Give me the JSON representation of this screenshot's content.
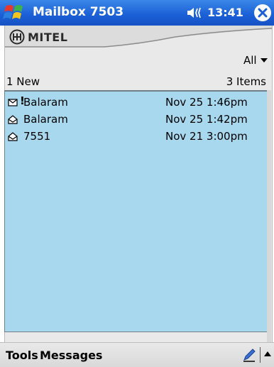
{
  "titlebar": {
    "title": "Mailbox 7503",
    "clock": "13:41"
  },
  "header": {
    "logo_text": "MITEL",
    "filter_value": "All",
    "new_count": "1 New",
    "item_count": "3 Items"
  },
  "messages": [
    {
      "sender": "Balaram",
      "date": "Nov 25 1:46pm",
      "priority": "!",
      "status_icon": "envelope-closed-icon"
    },
    {
      "sender": "Balaram",
      "date": "Nov 25 1:42pm",
      "priority": "",
      "status_icon": "envelope-open-icon"
    },
    {
      "sender": "7551",
      "date": "Nov 21 3:00pm",
      "priority": "",
      "status_icon": "envelope-open-icon"
    }
  ],
  "menubar": {
    "tools": "Tools",
    "messages": "Messages"
  },
  "colors": {
    "titlebar": "#1a5fd6",
    "list_bg": "#a7d8ee",
    "panel": "#e9e9e9"
  }
}
